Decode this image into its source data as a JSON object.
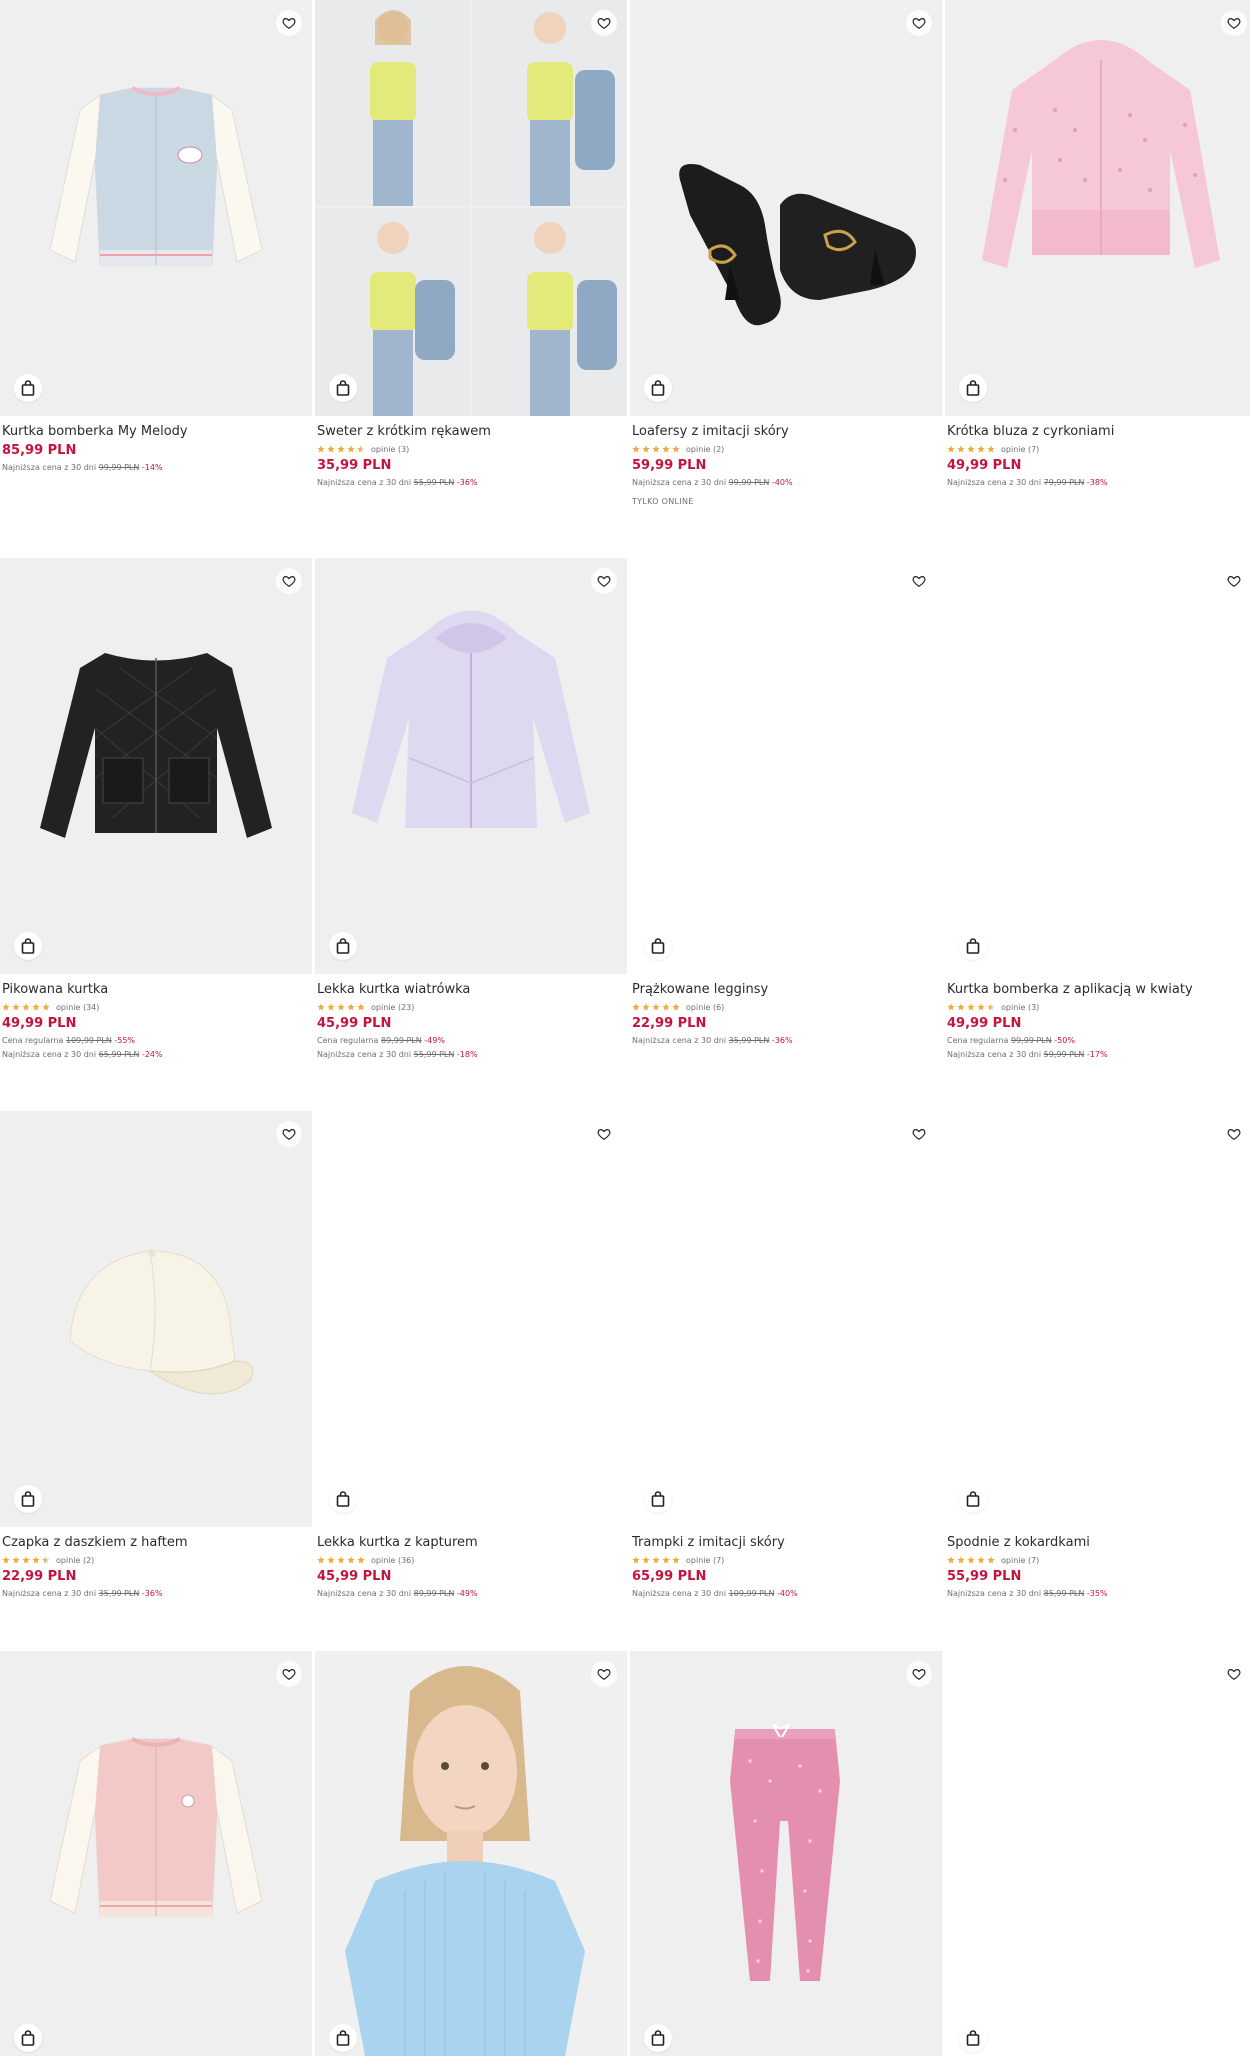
{
  "colors": {
    "price": "#c4143c",
    "star": "#f0a93b",
    "text": "#2b2b2b",
    "muted": "#6f6f6f"
  },
  "icons": {
    "favorite": "heart-icon",
    "bag": "shopping-bag-icon",
    "star": "star-icon"
  },
  "products": [
    {
      "name": "Kurtka bomberka My Melody",
      "price": "85,99 PLN",
      "rating": null,
      "meta": [
        {
          "label": "Najniższa cena z 30 dni",
          "old": "99,99 PLN",
          "discount": "-14%"
        }
      ],
      "badge": null
    },
    {
      "name": "Sweter z krótkim rękawem",
      "price": "35,99 PLN",
      "rating": {
        "stars": 4.5,
        "text": "opinie (3)"
      },
      "meta": [
        {
          "label": "Najniższa cena z 30 dni",
          "old": "55,99 PLN",
          "discount": "-36%"
        }
      ],
      "badge": null
    },
    {
      "name": "Loafersy z imitacji skóry",
      "price": "59,99 PLN",
      "rating": {
        "stars": 5,
        "text": "opinie (2)"
      },
      "meta": [
        {
          "label": "Najniższa cena z 30 dni",
          "old": "99,99 PLN",
          "discount": "-40%"
        }
      ],
      "badge": "TYLKO ONLINE"
    },
    {
      "name": "Krótka bluza z cyrkoniami",
      "price": "49,99 PLN",
      "rating": {
        "stars": 5,
        "text": "opinie (7)"
      },
      "meta": [
        {
          "label": "Najniższa cena z 30 dni",
          "old": "79,99 PLN",
          "discount": "-38%"
        }
      ],
      "badge": null
    },
    {
      "name": "Pikowana kurtka",
      "price": "49,99 PLN",
      "rating": {
        "stars": 5,
        "text": "opinie (34)"
      },
      "meta": [
        {
          "label": "Cena regularna",
          "old": "109,99 PLN",
          "discount": "-55%"
        },
        {
          "label": "Najniższa cena z 30 dni",
          "old": "65,99 PLN",
          "discount": "-24%"
        }
      ],
      "badge": null
    },
    {
      "name": "Lekka kurtka wiatrówka",
      "price": "45,99 PLN",
      "rating": {
        "stars": 5,
        "text": "opinie (23)"
      },
      "meta": [
        {
          "label": "Cena regularna",
          "old": "89,99 PLN",
          "discount": "-49%"
        },
        {
          "label": "Najniższa cena z 30 dni",
          "old": "55,99 PLN",
          "discount": "-18%"
        }
      ],
      "badge": null
    },
    {
      "name": "Prążkowane legginsy",
      "price": "22,99 PLN",
      "rating": {
        "stars": 5,
        "text": "opinie (6)"
      },
      "meta": [
        {
          "label": "Najniższa cena z 30 dni",
          "old": "35,99 PLN",
          "discount": "-36%"
        }
      ],
      "badge": null
    },
    {
      "name": "Kurtka bomberka z aplikacją w kwiaty",
      "price": "49,99 PLN",
      "rating": {
        "stars": 4.5,
        "text": "opinie (3)"
      },
      "meta": [
        {
          "label": "Cena regularna",
          "old": "99,99 PLN",
          "discount": "-50%"
        },
        {
          "label": "Najniższa cena z 30 dni",
          "old": "59,99 PLN",
          "discount": "-17%"
        }
      ],
      "badge": null
    },
    {
      "name": "Czapka z daszkiem z haftem",
      "price": "22,99 PLN",
      "rating": {
        "stars": 4.5,
        "text": "opinie (2)"
      },
      "meta": [
        {
          "label": "Najniższa cena z 30 dni",
          "old": "35,99 PLN",
          "discount": "-36%"
        }
      ],
      "badge": null
    },
    {
      "name": "Lekka kurtka z kapturem",
      "price": "45,99 PLN",
      "rating": {
        "stars": 5,
        "text": "opinie (36)"
      },
      "meta": [
        {
          "label": "Najniższa cena z 30 dni",
          "old": "89,99 PLN",
          "discount": "-49%"
        }
      ],
      "badge": null
    },
    {
      "name": "Trampki z imitacji skóry",
      "price": "65,99 PLN",
      "rating": {
        "stars": 5,
        "text": "opinie (7)"
      },
      "meta": [
        {
          "label": "Najniższa cena z 30 dni",
          "old": "109,99 PLN",
          "discount": "-40%"
        }
      ],
      "badge": null
    },
    {
      "name": "Spodnie z kokardkami",
      "price": "55,99 PLN",
      "rating": {
        "stars": 5,
        "text": "opinie (7)"
      },
      "meta": [
        {
          "label": "Najniższa cena z 30 dni",
          "old": "85,99 PLN",
          "discount": "-35%"
        }
      ],
      "badge": null
    },
    {
      "name": "",
      "price": "",
      "rating": null,
      "meta": [],
      "badge": null
    },
    {
      "name": "",
      "price": "",
      "rating": null,
      "meta": [],
      "badge": null
    },
    {
      "name": "",
      "price": "",
      "rating": null,
      "meta": [],
      "badge": null
    },
    {
      "name": "",
      "price": "",
      "rating": null,
      "meta": [],
      "badge": null
    }
  ]
}
